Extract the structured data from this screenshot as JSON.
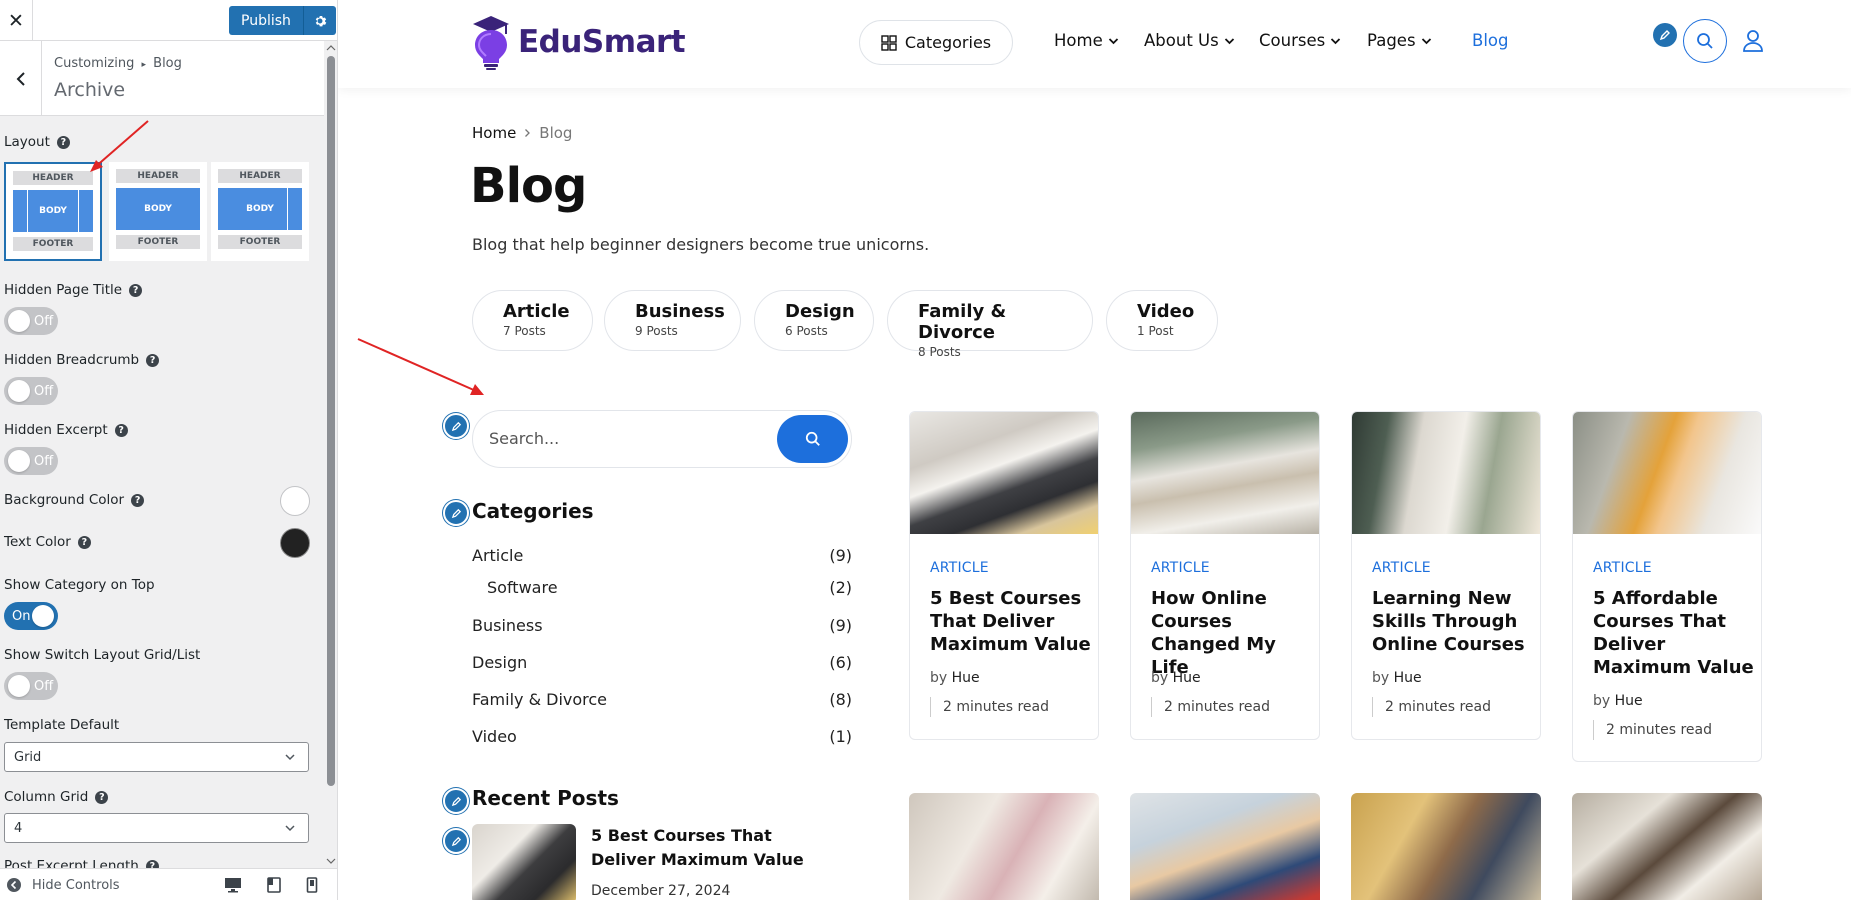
{
  "customizer": {
    "publish_label": "Publish",
    "breadcrumb_prefix": "Customizing",
    "breadcrumb_section": "Blog",
    "section_title": "Archive",
    "layout_label": "Layout",
    "layout_options": [
      {
        "header": "HEADER",
        "body": "BODY",
        "footer": "FOOTER"
      },
      {
        "header": "HEADER",
        "body": "BODY",
        "footer": "FOOTER"
      },
      {
        "header": "HEADER",
        "body": "BODY",
        "footer": "FOOTER"
      }
    ],
    "hidden_page_title": {
      "label": "Hidden Page Title",
      "state": "Off"
    },
    "hidden_breadcrumb": {
      "label": "Hidden Breadcrumb",
      "state": "Off"
    },
    "hidden_excerpt": {
      "label": "Hidden Excerpt",
      "state": "Off"
    },
    "background_color": {
      "label": "Background Color",
      "value": "#ffffff"
    },
    "text_color": {
      "label": "Text Color",
      "value": "#222222"
    },
    "show_category_top": {
      "label": "Show Category on Top",
      "state": "On"
    },
    "show_switch_layout": {
      "label": "Show Switch Layout Grid/List",
      "state": "Off"
    },
    "template_default": {
      "label": "Template Default",
      "value": "Grid"
    },
    "column_grid": {
      "label": "Column Grid",
      "value": "4"
    },
    "post_excerpt_length": {
      "label": "Post Excerpt Length"
    },
    "hide_controls_label": "Hide Controls"
  },
  "site": {
    "logo_text": "EduSmart",
    "categories_button": "Categories",
    "nav": [
      "Home",
      "About Us",
      "Courses",
      "Pages",
      "Blog"
    ],
    "breadcrumb_home": "Home",
    "breadcrumb_current": "Blog",
    "page_title": "Blog",
    "page_description": "Blog that help beginner designers become true unicorns.",
    "category_pills": [
      {
        "name": "Article",
        "count": "7 Posts"
      },
      {
        "name": "Business",
        "count": "9 Posts"
      },
      {
        "name": "Design",
        "count": "6 Posts"
      },
      {
        "name": "Family & Divorce",
        "count": "8 Posts"
      },
      {
        "name": "Video",
        "count": "1 Post"
      }
    ],
    "search_placeholder": "Search...",
    "categories_widget": {
      "title": "Categories",
      "items": [
        {
          "name": "Article",
          "count": "(9)"
        },
        {
          "name": "Software",
          "count": "(2)"
        },
        {
          "name": "Business",
          "count": "(9)"
        },
        {
          "name": "Design",
          "count": "(6)"
        },
        {
          "name": "Family & Divorce",
          "count": "(8)"
        },
        {
          "name": "Video",
          "count": "(1)"
        }
      ]
    },
    "recent_posts": {
      "title": "Recent Posts",
      "first_title": "5 Best Courses That Deliver Maximum Value",
      "first_date": "December 27, 2024"
    },
    "cards": [
      {
        "category": "ARTICLE",
        "title": "5 Best Courses That Deliver Maximum Value",
        "by": "by",
        "author": "Hue",
        "read": "2 minutes read"
      },
      {
        "category": "ARTICLE",
        "title": "How Online Courses Changed My Life",
        "by": "by",
        "author": "Hue",
        "read": "2 minutes read"
      },
      {
        "category": "ARTICLE",
        "title": "Learning New Skills Through Online Courses",
        "by": "by",
        "author": "Hue",
        "read": "2 minutes read"
      },
      {
        "category": "ARTICLE",
        "title": "5 Affordable Courses That Deliver Maximum Value",
        "by": "by",
        "author": "Hue",
        "read": "2 minutes read"
      }
    ],
    "colors": {
      "accent": "#1d6fdc",
      "brand": "#3a2379",
      "wp_blue": "#2271b1"
    }
  }
}
